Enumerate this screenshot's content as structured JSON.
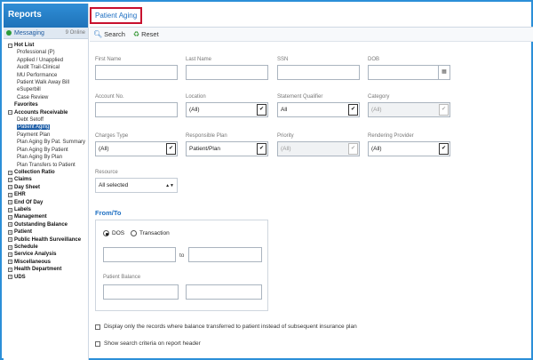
{
  "sidebar": {
    "title": "Reports",
    "messaging": {
      "label": "Messaging",
      "count": "9 Online"
    },
    "tree": [
      {
        "type": "sec",
        "box": "⊟",
        "label": "Hot List"
      },
      {
        "type": "child",
        "label": "Professional (P)"
      },
      {
        "type": "child",
        "label": "Applied / Unapplied"
      },
      {
        "type": "child",
        "label": "Audit Trail-Clinical"
      },
      {
        "type": "child",
        "label": "MU Performance"
      },
      {
        "type": "child",
        "label": "Patient Walk Away Bill"
      },
      {
        "type": "child",
        "label": "eSuperbill"
      },
      {
        "type": "child",
        "label": "Case Review"
      },
      {
        "type": "plain",
        "label": "Favorites"
      },
      {
        "type": "sec",
        "box": "⊟",
        "label": "Accounts Receivable"
      },
      {
        "type": "child",
        "label": "Debt Setoff"
      },
      {
        "type": "child",
        "label": "Patient Aging",
        "active": true
      },
      {
        "type": "child",
        "label": "Payment Plan"
      },
      {
        "type": "child",
        "label": "Plan Aging By Pat. Summary"
      },
      {
        "type": "child",
        "label": "Plan Aging By Patient"
      },
      {
        "type": "child",
        "label": "Plan Aging By Plan"
      },
      {
        "type": "child",
        "label": "Plan Transfers to Patient"
      },
      {
        "type": "sec",
        "box": "⊞",
        "label": "Collection Ratio"
      },
      {
        "type": "sec",
        "box": "⊞",
        "label": "Claims"
      },
      {
        "type": "sec",
        "box": "⊞",
        "label": "Day Sheet"
      },
      {
        "type": "sec",
        "box": "⊞",
        "label": "EHR"
      },
      {
        "type": "sec",
        "box": "⊞",
        "label": "End Of Day"
      },
      {
        "type": "sec",
        "box": "⊞",
        "label": "Labels"
      },
      {
        "type": "sec",
        "box": "⊞",
        "label": "Management"
      },
      {
        "type": "sec",
        "box": "⊞",
        "label": "Outstanding Balance"
      },
      {
        "type": "sec",
        "box": "⊞",
        "label": "Patient"
      },
      {
        "type": "sec",
        "box": "⊞",
        "label": "Public Health Surveillance"
      },
      {
        "type": "sec",
        "box": "⊞",
        "label": "Schedule"
      },
      {
        "type": "sec",
        "box": "⊞",
        "label": "Service Analysis"
      },
      {
        "type": "sec",
        "box": "⊞",
        "label": "Miscellaneous"
      },
      {
        "type": "sec",
        "box": "⊞",
        "label": "Health Department"
      },
      {
        "type": "sec",
        "box": "⊞",
        "label": "UDS"
      }
    ]
  },
  "tab": {
    "label": "Patient Aging"
  },
  "toolbar": {
    "search_label": "Search",
    "reset_label": "Reset"
  },
  "form": {
    "first_name": {
      "label": "First Name",
      "value": ""
    },
    "last_name": {
      "label": "Last Name",
      "value": ""
    },
    "ssn": {
      "label": "SSN",
      "value": ""
    },
    "dob": {
      "label": "DOB",
      "value": ""
    },
    "account_no": {
      "label": "Account No.",
      "value": ""
    },
    "location": {
      "label": "Location",
      "value": "(All)"
    },
    "statement_qualifier": {
      "label": "Statement Qualifier",
      "value": "All"
    },
    "category": {
      "label": "Category",
      "value": "(All)"
    },
    "charges_type": {
      "label": "Charges Type",
      "value": "(All)"
    },
    "responsible_plan": {
      "label": "Responsible Plan",
      "value": "Patient/Plan"
    },
    "priority": {
      "label": "Priority",
      "value": "(All)"
    },
    "rendering_provider": {
      "label": "Rendering Provider",
      "value": "(All)"
    },
    "resource": {
      "label": "Resource",
      "value": "All selected"
    },
    "from_to": {
      "title": "From/To",
      "dos_label": "DOS",
      "transaction_label": "Transaction",
      "to_label": "to",
      "patient_balance_label": "Patient Balance"
    },
    "check_transferred": "Display only the records where balance transferred to patient instead of subsequent insurance plan",
    "check_show_criteria": "Show search criteria on report header"
  }
}
